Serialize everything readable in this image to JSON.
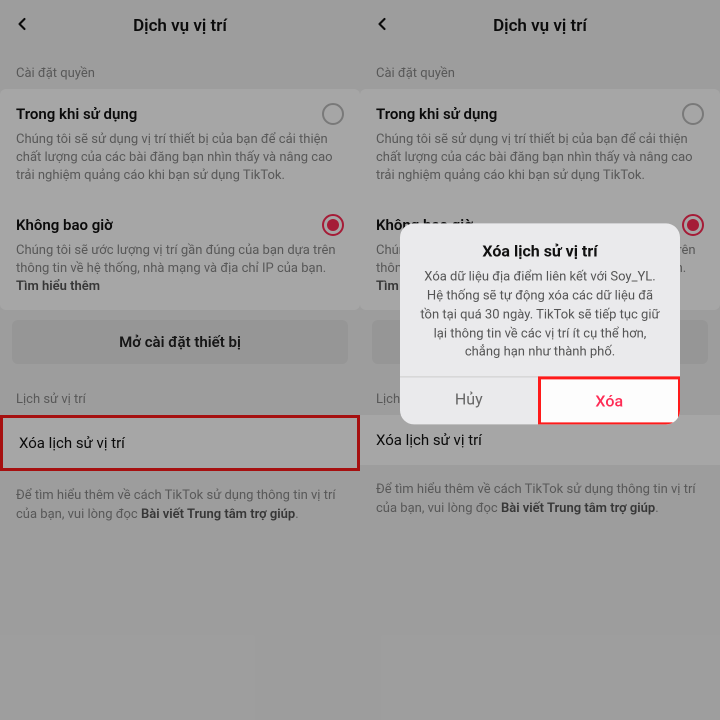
{
  "header": {
    "title": "Dịch vụ vị trí"
  },
  "perm_section_label": "Cài đặt quyền",
  "opt1": {
    "title": "Trong khi sử dụng",
    "desc": "Chúng tôi sẽ sử dụng vị trí thiết bị của bạn để cải thiện chất lượng của các bài đăng bạn nhìn thấy và nâng cao trải nghiệm quảng cáo khi bạn sử dụng TikTok."
  },
  "opt2": {
    "title": "Không bao giờ",
    "desc": "Chúng tôi sẽ ước lượng vị trí gần đúng của bạn dựa trên thông tin về hệ thống, nhà mạng và địa chỉ IP của bạn. ",
    "learn_more": "Tìm hiểu thêm"
  },
  "device_settings_btn": "Mở cài đặt thiết bị",
  "history_section_label": "Lịch sử vị trí",
  "clear_history_label": "Xóa lịch sử vị trí",
  "footer": {
    "text": "Để tìm hiểu thêm về cách TikTok sử dụng thông tin vị trí của bạn, vui lòng đọc ",
    "help_link": "Bài viết Trung tâm trợ giúp",
    "period": "."
  },
  "modal": {
    "title": "Xóa lịch sử vị trí",
    "body": "Xóa dữ liệu địa điểm liên kết với Soy_YL. Hệ thống sẽ tự động xóa các dữ liệu đã tồn tại quá 30 ngày. TikTok sẽ tiếp tục giữ lại thông tin về các vị trí ít cụ thể hơn, chẳng hạn như thành phố.",
    "cancel": "Hủy",
    "confirm": "Xóa"
  }
}
